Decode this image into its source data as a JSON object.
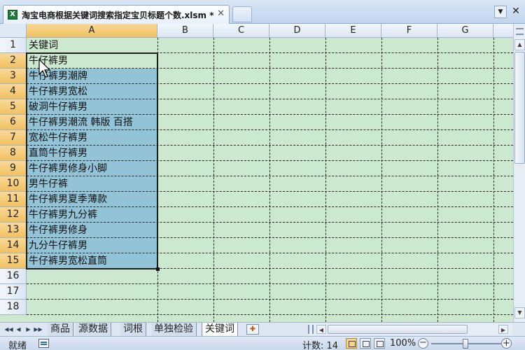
{
  "tab": {
    "title": "淘宝电商根据关键词搜索指定宝贝标题个数.xlsm *",
    "close": "✕"
  },
  "window": {
    "dropdown": "▼",
    "close": "✕"
  },
  "columns": [
    "A",
    "B",
    "C",
    "D",
    "E",
    "F",
    "G"
  ],
  "rows": [
    "1",
    "2",
    "3",
    "4",
    "5",
    "6",
    "7",
    "8",
    "9",
    "10",
    "11",
    "12",
    "13",
    "14",
    "15",
    "16",
    "17",
    "18"
  ],
  "cells": [
    "关键词",
    "牛仔裤男",
    "牛仔裤男潮牌",
    "牛仔裤男宽松",
    "破洞牛仔裤男",
    "牛仔裤男潮流  韩版  百搭",
    "宽松牛仔裤男",
    "直筒牛仔裤男",
    "牛仔裤男修身小脚",
    "男牛仔裤",
    "牛仔裤男夏季薄款",
    "牛仔裤男九分裤",
    "牛仔裤男修身",
    "九分牛仔裤男",
    "牛仔裤男宽松直筒"
  ],
  "sheet_nav": [
    "◀◀",
    "◀",
    "▶",
    "▶▶"
  ],
  "sheets": [
    "商品",
    "源数据",
    "词根",
    "单独检验",
    "关键词"
  ],
  "active_sheet": "关键词",
  "scroll": {
    "up": "▲",
    "down": "▼",
    "left": "◀",
    "right": "▶"
  },
  "status": {
    "ready": "就绪",
    "count": "计数: 14",
    "zoom": "100%",
    "zoom_out": "−",
    "zoom_in": "+"
  },
  "colors": {
    "grid_bg": "#cce8cf",
    "selection": "#93c3d7",
    "header_selected": "#f1c15f"
  }
}
